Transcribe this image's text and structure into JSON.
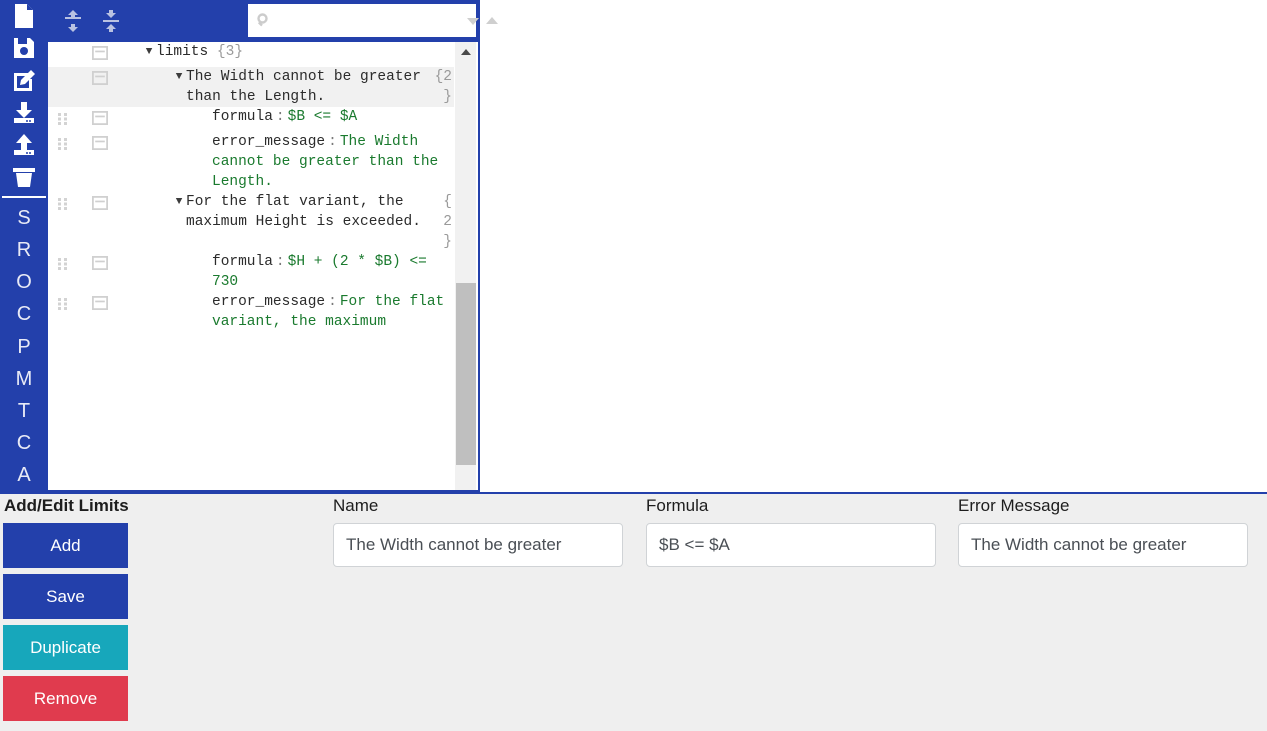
{
  "toolbar": {
    "icons": [
      {
        "name": "new-file-icon",
        "label": "New"
      },
      {
        "name": "save-icon",
        "label": "Save"
      },
      {
        "name": "edit-icon",
        "label": "Edit"
      },
      {
        "name": "download-icon",
        "label": "Download"
      },
      {
        "name": "upload-icon",
        "label": "Upload"
      },
      {
        "name": "trash-icon",
        "label": "Delete"
      }
    ],
    "letters": [
      "S",
      "R",
      "O",
      "C",
      "P",
      "M",
      "T",
      "C",
      "A"
    ]
  },
  "header": {
    "expand_all_icon": "expand-all-icon",
    "collapse_all_icon": "collapse-all-icon",
    "search": {
      "icon": "search-icon",
      "value": "",
      "placeholder": "",
      "next_icon": "chevron-down-icon",
      "prev_icon": "chevron-up-icon"
    }
  },
  "tree": {
    "rows": [
      {
        "indent": "ind0",
        "alt": false,
        "grip": false,
        "caret": "▼",
        "key": "limits",
        "colon": "",
        "value": "",
        "count": "{3}",
        "brace": ""
      },
      {
        "indent": "ind1",
        "alt": true,
        "grip": false,
        "caret": "▼",
        "key": "The Width cannot be greater than the Length.",
        "colon": "",
        "value": "",
        "count": "",
        "brace": "{2\n}"
      },
      {
        "indent": "ind2",
        "alt": false,
        "grip": true,
        "caret": "",
        "key": "formula",
        "colon": ":",
        "value": "$B <= $A",
        "count": "",
        "brace": ""
      },
      {
        "indent": "ind2",
        "alt": false,
        "grip": true,
        "caret": "",
        "key": "error_message",
        "colon": ":",
        "value": "The Width cannot be greater than the Length.",
        "count": "",
        "brace": ""
      },
      {
        "indent": "ind1",
        "alt": false,
        "grip": true,
        "caret": "▼",
        "key": "For the flat variant, the maximum Height is exceeded.",
        "colon": "",
        "value": "",
        "count": "",
        "brace": "{\n2\n}"
      },
      {
        "indent": "ind2",
        "alt": false,
        "grip": true,
        "caret": "",
        "key": "formula",
        "colon": ":",
        "value": "$H + (2 * $B) <= 730",
        "count": "",
        "brace": ""
      },
      {
        "indent": "ind2",
        "alt": false,
        "grip": true,
        "caret": "",
        "key": "error_message",
        "colon": ":",
        "value": "For the flat variant, the maximum",
        "count": "",
        "brace": ""
      }
    ],
    "scrollbar": {
      "up_icon": "scroll-up-arrow-icon"
    }
  },
  "editor": {
    "title": "Add/Edit Limits",
    "buttons": [
      {
        "name": "add-button",
        "label": "Add",
        "class": "btn-add"
      },
      {
        "name": "save-button",
        "label": "Save",
        "class": "btn-save"
      },
      {
        "name": "duplicate-button",
        "label": "Duplicate",
        "class": "btn-dup"
      },
      {
        "name": "remove-button",
        "label": "Remove",
        "class": "btn-rem"
      }
    ],
    "fields": {
      "name": {
        "label": "Name",
        "value": "The Width cannot be greater",
        "placeholder": "Name"
      },
      "formula": {
        "label": "Formula",
        "value": "$B <= $A",
        "placeholder": "Formula"
      },
      "error_message": {
        "label": "Error Message",
        "value": "The Width cannot be greater",
        "placeholder": "Error Message"
      }
    }
  },
  "colors": {
    "brand_blue": "#2340ab",
    "teal": "#17a7bb",
    "red": "#e03b4e",
    "value_green": "#1a7a2e",
    "panel_gray": "#efefef"
  }
}
